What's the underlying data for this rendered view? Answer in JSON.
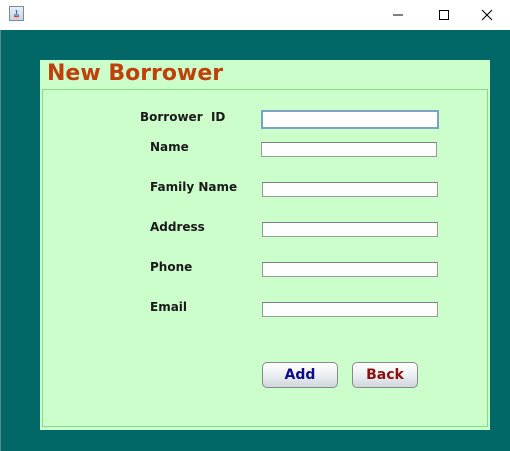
{
  "window": {
    "icon": "java-app-icon",
    "controls": [
      "minimize-icon",
      "maximize-icon",
      "close-icon"
    ]
  },
  "colors": {
    "background": "#016867",
    "panel": "#ccfecc",
    "title": "#c0400b",
    "add_text": "#0b0b8a",
    "back_text": "#8b1010"
  },
  "form": {
    "title": "New Borrower",
    "fields": [
      {
        "label": "Borrower  ID",
        "value": ""
      },
      {
        "label": "Name",
        "value": ""
      },
      {
        "label": "Family Name",
        "value": ""
      },
      {
        "label": "Address",
        "value": ""
      },
      {
        "label": "Phone",
        "value": ""
      },
      {
        "label": "Email",
        "value": ""
      }
    ],
    "buttons": {
      "add": "Add",
      "back": "Back"
    }
  }
}
